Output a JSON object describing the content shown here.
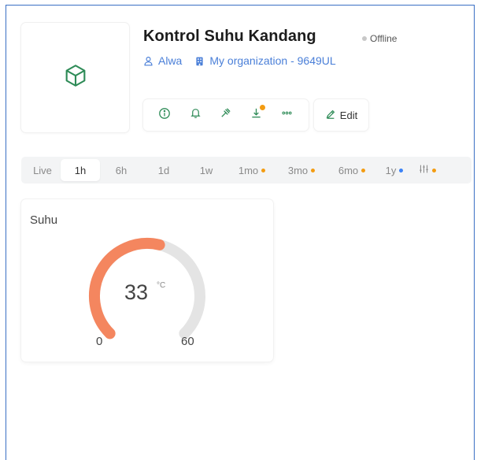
{
  "device": {
    "icon": "cube-icon",
    "title": "Kontrol Suhu Kandang",
    "status": "Offline",
    "owner": "Alwa",
    "organization": "My organization - 9649UL"
  },
  "toolbar": {
    "buttons": [
      {
        "icon": "info-icon"
      },
      {
        "icon": "bell-icon"
      },
      {
        "icon": "tools-icon"
      },
      {
        "icon": "download-icon",
        "badge": true
      },
      {
        "icon": "more-icon"
      }
    ],
    "edit_label": "Edit"
  },
  "timerange": {
    "tabs": [
      {
        "label": "Live"
      },
      {
        "label": "1h",
        "active": true
      },
      {
        "label": "6h"
      },
      {
        "label": "1d"
      },
      {
        "label": "1w"
      },
      {
        "label": "1mo",
        "dot": "#f39c12"
      },
      {
        "label": "3mo",
        "dot": "#f39c12"
      },
      {
        "label": "6mo",
        "dot": "#f39c12"
      },
      {
        "label": "1y",
        "dot": "#3b82f6"
      },
      {
        "label": "",
        "dot": "#f39c12"
      }
    ]
  },
  "widget": {
    "title": "Suhu",
    "value": "33",
    "unit": "°C",
    "min": "0",
    "max": "60",
    "fraction": 0.55,
    "color": "#f4865f"
  },
  "colors": {
    "accent_green": "#2e8b57",
    "link_blue": "#4a7fd8",
    "gauge_track": "#e4e4e4"
  }
}
